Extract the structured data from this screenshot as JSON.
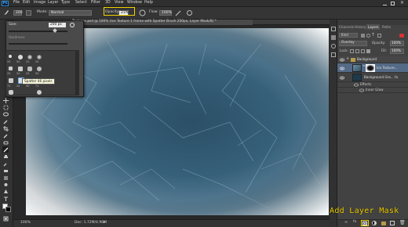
{
  "app": {
    "logo": "Ps"
  },
  "menu": [
    "File",
    "Edit",
    "Image",
    "Layer",
    "Type",
    "Select",
    "Filter",
    "3D",
    "View",
    "Window",
    "Help"
  ],
  "options": {
    "brush_size": "200",
    "mode_label": "Mode:",
    "mode_value": "Normal",
    "opacity_label": "Opacity:",
    "opacity_value": "23%",
    "flow_label": "Flow:",
    "flow_value": "100%"
  },
  "brush_panel": {
    "size_label": "Size:",
    "size_value": "200 px",
    "hardness_label": "Hardness:",
    "preset_sizes": [
      "25",
      "50",
      "25",
      "25",
      "25",
      "50",
      "25",
      "50",
      "71",
      "25",
      "50",
      "71"
    ],
    "tooltip": "Spatter 46 pixels"
  },
  "document": {
    "tab_title": "Textures.psd @ 100% (Ice Texture 1 frame with Spatter Brush 200px, Layer Mask/8) *",
    "zoom": "100%",
    "doc_size": "Doc: 1.72M/4.96M"
  },
  "panels": {
    "top_tabs": [
      "Channels",
      "History",
      "Layers",
      "Paths"
    ],
    "active_tab": "Layers",
    "kind_label": "Kind",
    "blend_mode": "Overlay",
    "opacity_label": "Opacity:",
    "opacity_value": "100%",
    "lock_label": "Lock:",
    "fill_label": "Fill:",
    "fill_value": "100%",
    "layers": [
      {
        "name": "Background",
        "type": "group"
      },
      {
        "name": "Ice Texture...",
        "type": "layer"
      },
      {
        "name": "Background Gra... fx",
        "type": "layer"
      },
      {
        "name": "Effects",
        "type": "effects"
      },
      {
        "name": "Inner Glow",
        "type": "effect"
      }
    ]
  },
  "caption": "Add Layer Mask",
  "colors": {
    "highlight": "#f2d000",
    "ice_center": "#2e5670",
    "ice_edge": "#e8eef2"
  }
}
